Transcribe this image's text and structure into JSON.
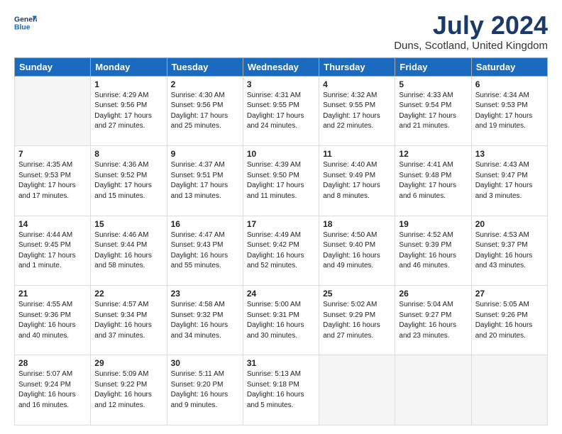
{
  "logo": {
    "line1": "General",
    "line2": "Blue"
  },
  "title": "July 2024",
  "subtitle": "Duns, Scotland, United Kingdom",
  "days_of_week": [
    "Sunday",
    "Monday",
    "Tuesday",
    "Wednesday",
    "Thursday",
    "Friday",
    "Saturday"
  ],
  "weeks": [
    [
      {
        "num": "",
        "empty": true
      },
      {
        "num": "1",
        "sunrise": "Sunrise: 4:29 AM",
        "sunset": "Sunset: 9:56 PM",
        "daylight": "Daylight: 17 hours and 27 minutes."
      },
      {
        "num": "2",
        "sunrise": "Sunrise: 4:30 AM",
        "sunset": "Sunset: 9:56 PM",
        "daylight": "Daylight: 17 hours and 25 minutes."
      },
      {
        "num": "3",
        "sunrise": "Sunrise: 4:31 AM",
        "sunset": "Sunset: 9:55 PM",
        "daylight": "Daylight: 17 hours and 24 minutes."
      },
      {
        "num": "4",
        "sunrise": "Sunrise: 4:32 AM",
        "sunset": "Sunset: 9:55 PM",
        "daylight": "Daylight: 17 hours and 22 minutes."
      },
      {
        "num": "5",
        "sunrise": "Sunrise: 4:33 AM",
        "sunset": "Sunset: 9:54 PM",
        "daylight": "Daylight: 17 hours and 21 minutes."
      },
      {
        "num": "6",
        "sunrise": "Sunrise: 4:34 AM",
        "sunset": "Sunset: 9:53 PM",
        "daylight": "Daylight: 17 hours and 19 minutes."
      }
    ],
    [
      {
        "num": "7",
        "sunrise": "Sunrise: 4:35 AM",
        "sunset": "Sunset: 9:53 PM",
        "daylight": "Daylight: 17 hours and 17 minutes."
      },
      {
        "num": "8",
        "sunrise": "Sunrise: 4:36 AM",
        "sunset": "Sunset: 9:52 PM",
        "daylight": "Daylight: 17 hours and 15 minutes."
      },
      {
        "num": "9",
        "sunrise": "Sunrise: 4:37 AM",
        "sunset": "Sunset: 9:51 PM",
        "daylight": "Daylight: 17 hours and 13 minutes."
      },
      {
        "num": "10",
        "sunrise": "Sunrise: 4:39 AM",
        "sunset": "Sunset: 9:50 PM",
        "daylight": "Daylight: 17 hours and 11 minutes."
      },
      {
        "num": "11",
        "sunrise": "Sunrise: 4:40 AM",
        "sunset": "Sunset: 9:49 PM",
        "daylight": "Daylight: 17 hours and 8 minutes."
      },
      {
        "num": "12",
        "sunrise": "Sunrise: 4:41 AM",
        "sunset": "Sunset: 9:48 PM",
        "daylight": "Daylight: 17 hours and 6 minutes."
      },
      {
        "num": "13",
        "sunrise": "Sunrise: 4:43 AM",
        "sunset": "Sunset: 9:47 PM",
        "daylight": "Daylight: 17 hours and 3 minutes."
      }
    ],
    [
      {
        "num": "14",
        "sunrise": "Sunrise: 4:44 AM",
        "sunset": "Sunset: 9:45 PM",
        "daylight": "Daylight: 17 hours and 1 minute."
      },
      {
        "num": "15",
        "sunrise": "Sunrise: 4:46 AM",
        "sunset": "Sunset: 9:44 PM",
        "daylight": "Daylight: 16 hours and 58 minutes."
      },
      {
        "num": "16",
        "sunrise": "Sunrise: 4:47 AM",
        "sunset": "Sunset: 9:43 PM",
        "daylight": "Daylight: 16 hours and 55 minutes."
      },
      {
        "num": "17",
        "sunrise": "Sunrise: 4:49 AM",
        "sunset": "Sunset: 9:42 PM",
        "daylight": "Daylight: 16 hours and 52 minutes."
      },
      {
        "num": "18",
        "sunrise": "Sunrise: 4:50 AM",
        "sunset": "Sunset: 9:40 PM",
        "daylight": "Daylight: 16 hours and 49 minutes."
      },
      {
        "num": "19",
        "sunrise": "Sunrise: 4:52 AM",
        "sunset": "Sunset: 9:39 PM",
        "daylight": "Daylight: 16 hours and 46 minutes."
      },
      {
        "num": "20",
        "sunrise": "Sunrise: 4:53 AM",
        "sunset": "Sunset: 9:37 PM",
        "daylight": "Daylight: 16 hours and 43 minutes."
      }
    ],
    [
      {
        "num": "21",
        "sunrise": "Sunrise: 4:55 AM",
        "sunset": "Sunset: 9:36 PM",
        "daylight": "Daylight: 16 hours and 40 minutes."
      },
      {
        "num": "22",
        "sunrise": "Sunrise: 4:57 AM",
        "sunset": "Sunset: 9:34 PM",
        "daylight": "Daylight: 16 hours and 37 minutes."
      },
      {
        "num": "23",
        "sunrise": "Sunrise: 4:58 AM",
        "sunset": "Sunset: 9:32 PM",
        "daylight": "Daylight: 16 hours and 34 minutes."
      },
      {
        "num": "24",
        "sunrise": "Sunrise: 5:00 AM",
        "sunset": "Sunset: 9:31 PM",
        "daylight": "Daylight: 16 hours and 30 minutes."
      },
      {
        "num": "25",
        "sunrise": "Sunrise: 5:02 AM",
        "sunset": "Sunset: 9:29 PM",
        "daylight": "Daylight: 16 hours and 27 minutes."
      },
      {
        "num": "26",
        "sunrise": "Sunrise: 5:04 AM",
        "sunset": "Sunset: 9:27 PM",
        "daylight": "Daylight: 16 hours and 23 minutes."
      },
      {
        "num": "27",
        "sunrise": "Sunrise: 5:05 AM",
        "sunset": "Sunset: 9:26 PM",
        "daylight": "Daylight: 16 hours and 20 minutes."
      }
    ],
    [
      {
        "num": "28",
        "sunrise": "Sunrise: 5:07 AM",
        "sunset": "Sunset: 9:24 PM",
        "daylight": "Daylight: 16 hours and 16 minutes."
      },
      {
        "num": "29",
        "sunrise": "Sunrise: 5:09 AM",
        "sunset": "Sunset: 9:22 PM",
        "daylight": "Daylight: 16 hours and 12 minutes."
      },
      {
        "num": "30",
        "sunrise": "Sunrise: 5:11 AM",
        "sunset": "Sunset: 9:20 PM",
        "daylight": "Daylight: 16 hours and 9 minutes."
      },
      {
        "num": "31",
        "sunrise": "Sunrise: 5:13 AM",
        "sunset": "Sunset: 9:18 PM",
        "daylight": "Daylight: 16 hours and 5 minutes."
      },
      {
        "num": "",
        "empty": true
      },
      {
        "num": "",
        "empty": true
      },
      {
        "num": "",
        "empty": true
      }
    ]
  ]
}
